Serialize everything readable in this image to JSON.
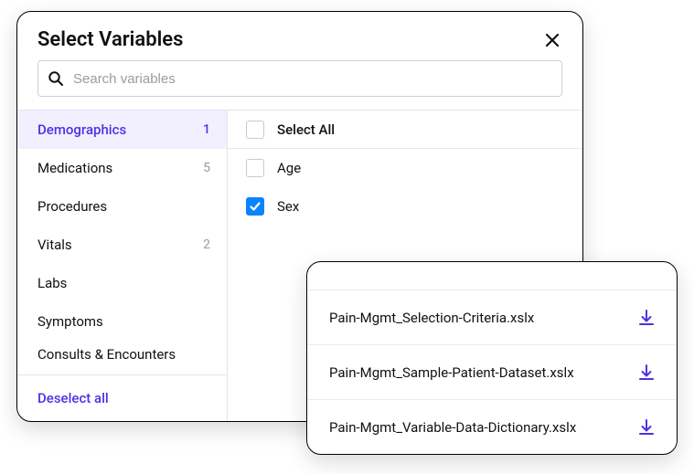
{
  "select": {
    "title": "Select Variables",
    "search_placeholder": "Search variables",
    "deselect_label": "Deselect all",
    "select_all_label": "Select All"
  },
  "categories": [
    {
      "label": "Demographics",
      "count": "1",
      "active": true
    },
    {
      "label": "Medications",
      "count": "5",
      "active": false
    },
    {
      "label": "Procedures",
      "count": "",
      "active": false
    },
    {
      "label": "Vitals",
      "count": "2",
      "active": false
    },
    {
      "label": "Labs",
      "count": "",
      "active": false
    },
    {
      "label": "Symptoms",
      "count": "",
      "active": false
    },
    {
      "label": "Consults & Encounters",
      "count": "",
      "active": false,
      "cut": true
    }
  ],
  "variables": [
    {
      "label": "Age",
      "checked": false
    },
    {
      "label": "Sex",
      "checked": true
    }
  ],
  "files": [
    {
      "name": "Pain-Mgmt_Selection-Criteria.xslx"
    },
    {
      "name": "Pain-Mgmt_Sample-Patient-Dataset.xslx"
    },
    {
      "name": "Pain-Mgmt_Variable-Data-Dictionary.xslx"
    }
  ]
}
